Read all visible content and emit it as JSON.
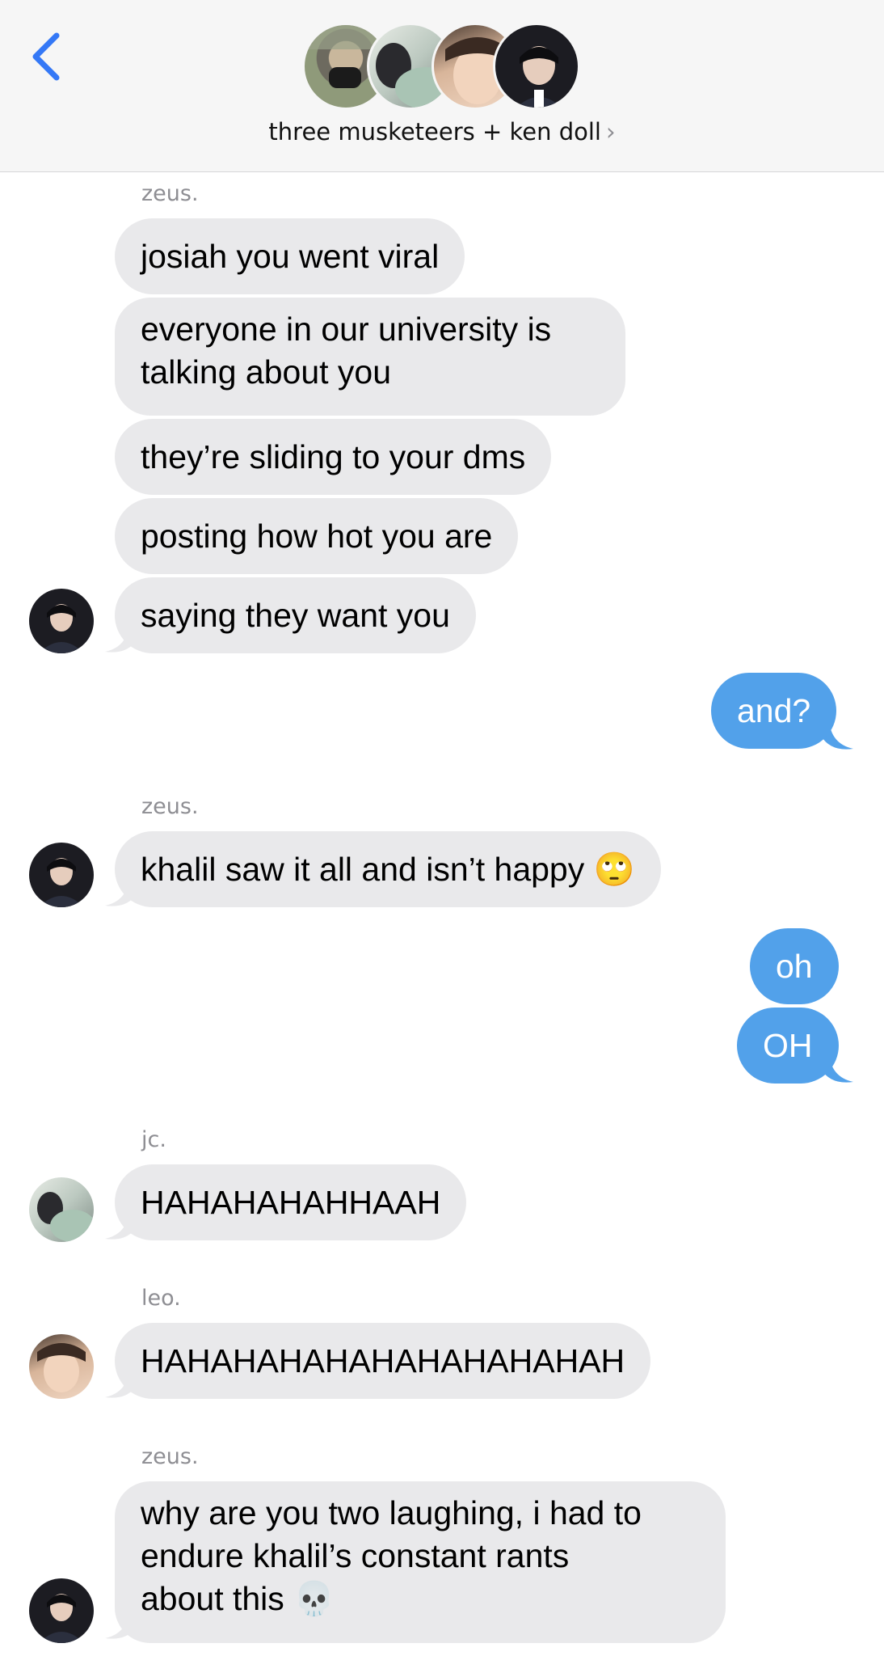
{
  "header": {
    "title": "three musketeers + ken doll",
    "chevron": "›",
    "back_icon": "chevron-left-icon"
  },
  "colors": {
    "accent": "#3478f6",
    "incoming_bubble": "#e9e9eb",
    "outgoing_bubble": "#52a1ea"
  },
  "messages": {
    "sender_zeus_1": "zeus.",
    "m1": "josiah you went viral",
    "m2_line1": "everyone in our university is",
    "m2_line2": "talking about you",
    "m3": "they’re sliding to your dms",
    "m4": "posting how hot you are",
    "m5": "saying they want you",
    "out1": "and?",
    "sender_zeus_2": "zeus.",
    "m6": "khalil saw it all and isn’t happy 🙄",
    "out2": "oh",
    "out3": "OH",
    "sender_jc": "jc.",
    "m7": "HAHAHAHAHHAAH",
    "sender_leo": "leo.",
    "m8": "HAHAHAHAHAHAHAHAHAHAH",
    "sender_zeus_3": "zeus.",
    "m9_line1": "why are you two laughing, i had to",
    "m9_line2": "endure khalil’s constant rants",
    "m9_line3": "about this 💀"
  }
}
